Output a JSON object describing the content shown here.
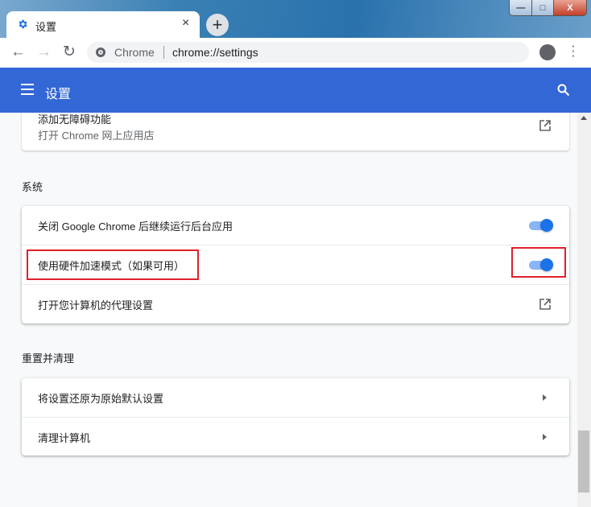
{
  "tab": {
    "title": "设置",
    "icon": "gear-icon",
    "close": "×"
  },
  "new_tab": "+",
  "window": {
    "minimize": "—",
    "maximize": "□",
    "close": "X"
  },
  "omnibox": {
    "site_label": "Chrome",
    "url": "chrome://settings"
  },
  "header": {
    "title": "设置"
  },
  "accessibility_card": {
    "title": "添加无障碍功能",
    "subtitle": "打开 Chrome 网上应用店"
  },
  "system": {
    "heading": "系统",
    "items": [
      {
        "label": "关闭 Google Chrome 后继续运行后台应用",
        "type": "toggle",
        "on": true
      },
      {
        "label": "使用硬件加速模式（如果可用）",
        "type": "toggle",
        "on": true
      },
      {
        "label": "打开您计算机的代理设置",
        "type": "external-link"
      }
    ]
  },
  "reset": {
    "heading": "重置并清理",
    "items": [
      {
        "label": "将设置还原为原始默认设置"
      },
      {
        "label": "清理计算机"
      }
    ]
  },
  "colors": {
    "header": "#3367d6",
    "toggle": "#1a73e8",
    "highlight": "#e0202a"
  }
}
